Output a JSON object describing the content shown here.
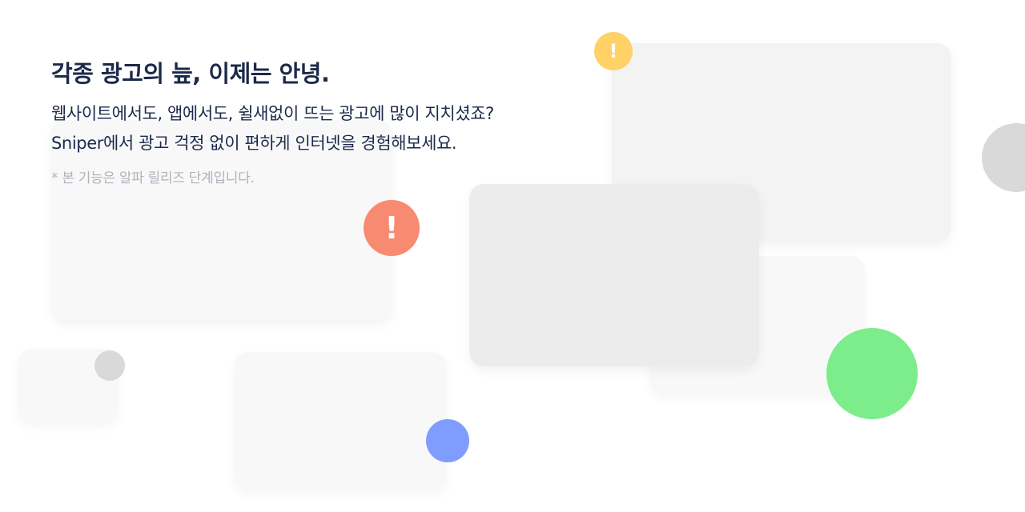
{
  "hero": {
    "headline": "각종 광고의 늪, 이제는 안녕.",
    "body_line_1": "웹사이트에서도, 앱에서도, 쉴새없이 뜨는 광고에 많이 지치셨죠?",
    "body_line_2": "Sniper에서 광고 걱정 없이 편하게 인터넷을 경험해보세요.",
    "note": "* 본 기능은 알파 릴리즈 단계입니다."
  },
  "decorations": {
    "alert_small": {
      "icon": "exclamation-icon",
      "glyph": "!",
      "color": "#ffd166"
    },
    "alert_large": {
      "icon": "exclamation-icon",
      "glyph": "!",
      "color": "#f88a72"
    },
    "circle_grey_large": {
      "color": "#d9d9d9"
    },
    "circle_grey_small": {
      "color": "#d9d9d9"
    },
    "circle_blue": {
      "color": "#7f9dff"
    },
    "circle_green": {
      "color": "#7ced8a"
    }
  },
  "colors": {
    "headline": "#1c2a4a",
    "note": "#aeb3bc"
  }
}
